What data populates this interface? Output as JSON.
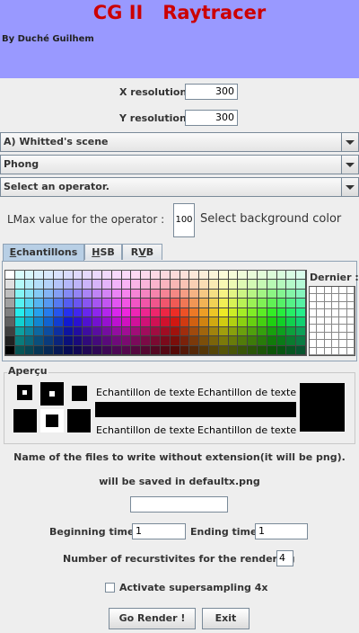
{
  "header": {
    "title": "CG II   Raytracer",
    "author": "By Duché Guilhem"
  },
  "resolution": {
    "x_label": "X resolution",
    "x_value": "300",
    "y_label": "Y resolution",
    "y_value": "300"
  },
  "dropdowns": {
    "scene": "A) Whitted's scene",
    "shading": "Phong",
    "operator": "Select an operator."
  },
  "lmax": {
    "label": "LMax value for the operator :",
    "value": "100",
    "bg_color_label": "Select background color"
  },
  "color_chooser": {
    "tabs": [
      {
        "label": "Echantillons",
        "mnemonic": "E",
        "rest": "chantillons"
      },
      {
        "label": "HSB",
        "mnemonic": "H",
        "rest": "SB"
      },
      {
        "label": "RVB",
        "mnemonic": "V",
        "pre": "R",
        "rest": "B"
      }
    ],
    "recent_label": "Dernier :",
    "preview_label": "Aperçu",
    "sample_text": "Echantillon de texte"
  },
  "output": {
    "files_label": "Name of the files to write without extension(it will be png).",
    "saved_label": "will be saved in defaultx.png",
    "filename_value": ""
  },
  "timing": {
    "begin_label": "Beginning time:",
    "begin_value": "1",
    "end_label": "Ending time",
    "end_value": "1"
  },
  "recursion": {
    "label": "Number of recurstivites for the rendering",
    "value": "4"
  },
  "supersampling": {
    "label": "Activate supersampling 4x",
    "checked": false
  },
  "buttons": {
    "render": "Go Render !",
    "exit": "Exit"
  },
  "colors": {
    "header_bg": "#9999ff",
    "title": "#cc0000",
    "panel_bg": "#eeeeee"
  }
}
